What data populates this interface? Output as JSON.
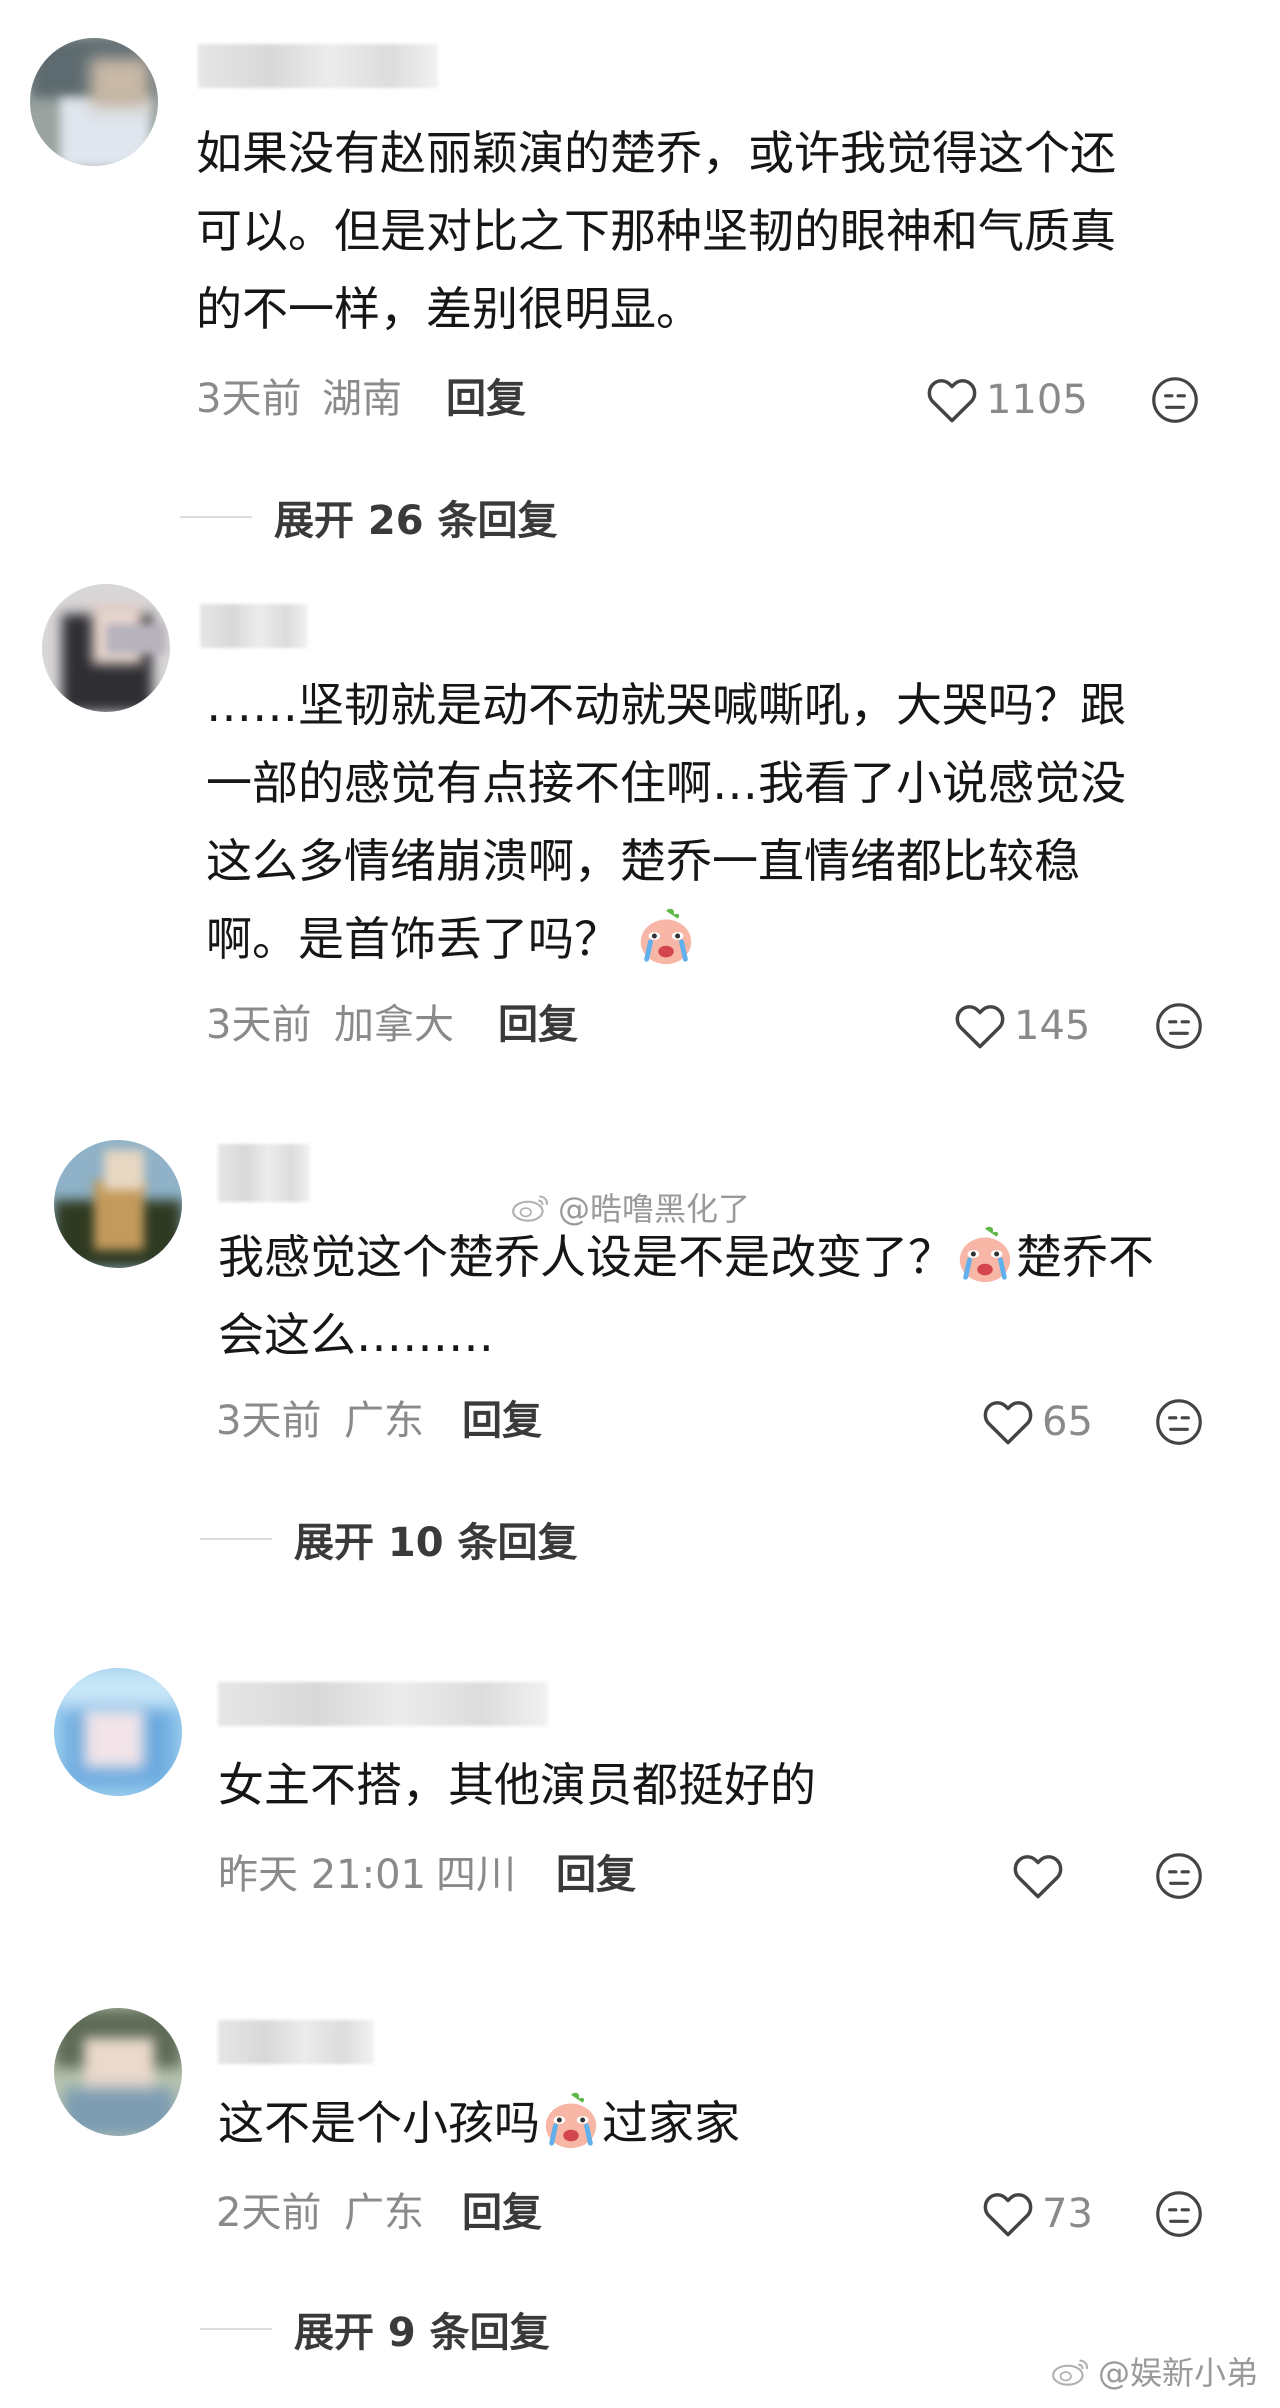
{
  "comments": [
    {
      "text_lines": [
        "如果没有赵丽颖演的楚乔，或许我觉得这个还",
        "可以。但是对比之下那种坚韧的眼神和气质真",
        "的不一样，差别很明显。"
      ],
      "time": "3天前",
      "location": "湖南",
      "reply_label": "回复",
      "likes": "1105",
      "expand_label": "展开 26 条回复"
    },
    {
      "text_lines": [
        "……坚韧就是动不动就哭喊嘶吼，大哭吗？跟",
        "一部的感觉有点接不住啊…我看了小说感觉没",
        "这么多情绪崩溃啊，楚乔一直情绪都比较稳",
        "啊。是首饰丢了吗？"
      ],
      "time": "3天前",
      "location": "加拿大",
      "reply_label": "回复",
      "likes": "145"
    },
    {
      "text_line1_a": "我感觉这个楚乔人设是不是改变了？",
      "text_line1_b": "楚乔不",
      "text_line2": "会这么………",
      "time": "3天前",
      "location": "广东",
      "reply_label": "回复",
      "likes": "65",
      "expand_label": "展开 10 条回复"
    },
    {
      "text_lines": [
        "女主不搭，其他演员都挺好的"
      ],
      "time": "昨天 21:01",
      "location": "四川",
      "reply_label": "回复",
      "likes": ""
    },
    {
      "text_a": "这不是个小孩吗",
      "text_b": "过家家",
      "time": "2天前",
      "location": "广东",
      "reply_label": "回复",
      "likes": "73",
      "expand_label": "展开 9 条回复"
    }
  ],
  "watermarks": {
    "middle": "@晧噜黑化了",
    "bottom": "@娱新小弟"
  },
  "icons": {
    "like": "heart-outline-icon",
    "dislike": "neutral-face-icon",
    "emoji": "crying-face-emoji",
    "watermark": "weibo-logo-icon"
  },
  "colors": {
    "text": "#161616",
    "meta": "#8a8a8a",
    "divider": "#dcdcdc"
  }
}
